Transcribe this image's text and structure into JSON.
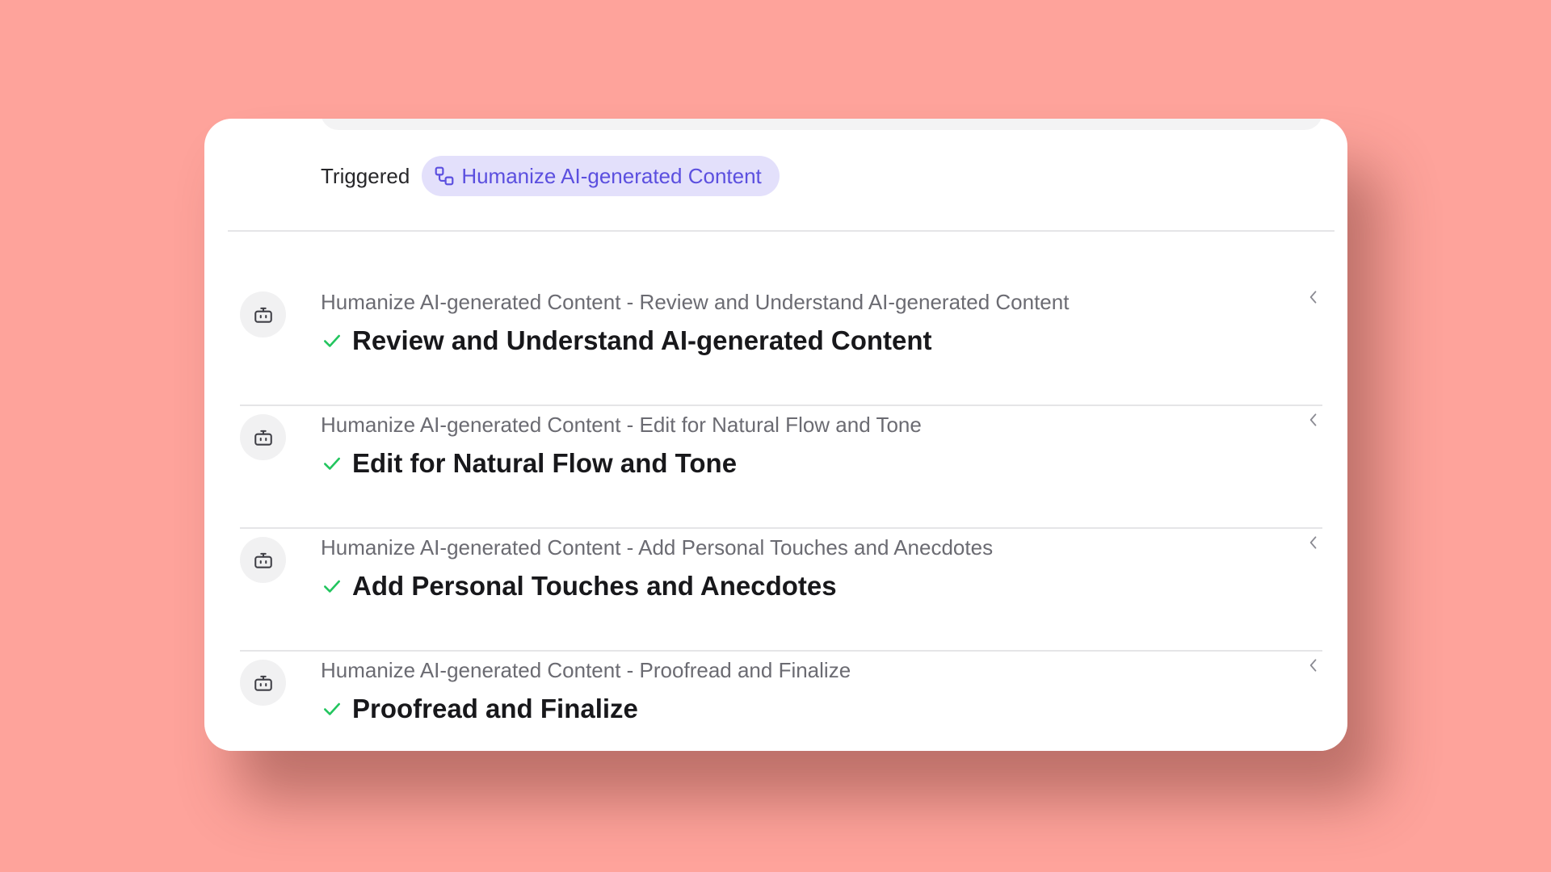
{
  "colors": {
    "background": "#FEA39B",
    "card": "#FFFFFF",
    "accent": "#5B4FDF",
    "accent_bg": "#E3E0FB",
    "success": "#22C55E"
  },
  "trigger": {
    "label": "Triggered",
    "workflow_icon": "workflow-icon",
    "workflow_name": "Humanize AI-generated Content"
  },
  "steps": [
    {
      "icon": "robot-icon",
      "subtitle": "Humanize AI-generated Content - Review and Understand AI-generated Content",
      "status_icon": "check-icon",
      "title": "Review and Understand AI-generated Content",
      "expand_icon": "chevron-left-icon"
    },
    {
      "icon": "robot-icon",
      "subtitle": "Humanize AI-generated Content - Edit for Natural Flow and Tone",
      "status_icon": "check-icon",
      "title": "Edit for Natural Flow and Tone",
      "expand_icon": "chevron-left-icon"
    },
    {
      "icon": "robot-icon",
      "subtitle": "Humanize AI-generated Content - Add Personal Touches and Anecdotes",
      "status_icon": "check-icon",
      "title": "Add Personal Touches and Anecdotes",
      "expand_icon": "chevron-left-icon"
    },
    {
      "icon": "robot-icon",
      "subtitle": "Humanize AI-generated Content - Proofread and Finalize",
      "status_icon": "check-icon",
      "title": "Proofread and Finalize",
      "expand_icon": "chevron-left-icon"
    }
  ]
}
